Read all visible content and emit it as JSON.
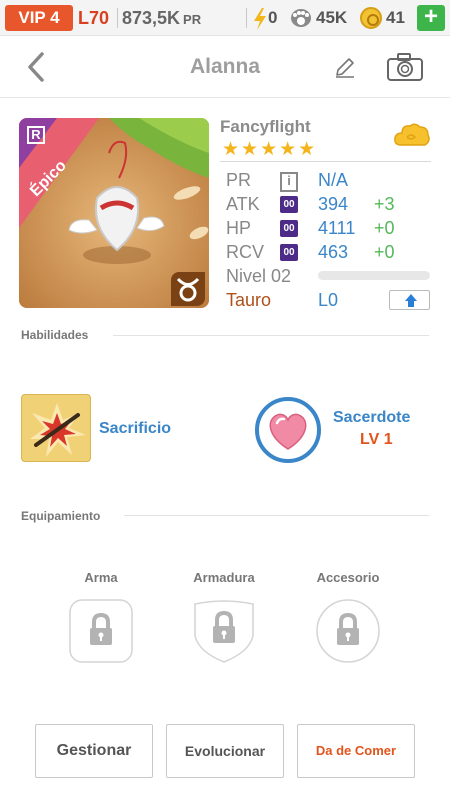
{
  "statusbar": {
    "vip": "VIP 4",
    "level": "L70",
    "power": "873,5K",
    "power_unit": "PR",
    "energy": "0",
    "paws": "45K",
    "coins": "41",
    "add": "+"
  },
  "header": {
    "title": "Alanna"
  },
  "card": {
    "rarity_letter": "R",
    "rarity": "Épico"
  },
  "pet": {
    "name": "Fancyflight",
    "stars": 5,
    "stars_text": "★★★★★",
    "stats": {
      "pr_label": "PR",
      "pr_value": "N/A",
      "atk_label": "ATK",
      "atk_badge": "00",
      "atk_value": "394",
      "atk_bonus": "+3",
      "hp_label": "HP",
      "hp_badge": "00",
      "hp_value": "4111",
      "hp_bonus": "+0",
      "rcv_label": "RCV",
      "rcv_badge": "00",
      "rcv_value": "463",
      "rcv_bonus": "+0",
      "level_label": "Nivel 02",
      "level_progress": 0,
      "sign_label": "Tauro",
      "sign_level": "L0"
    }
  },
  "sections": {
    "skills": "Habilidades",
    "equipment": "Equipamiento"
  },
  "skills": [
    {
      "name": "Sacrificio"
    },
    {
      "name": "Sacerdote",
      "level": "LV 1"
    }
  ],
  "equipment": [
    {
      "label": "Arma"
    },
    {
      "label": "Armadura"
    },
    {
      "label": "Accesorio"
    }
  ],
  "actions": {
    "manage": "Gestionar",
    "evolve": "Evolucionar",
    "feed": "Da de Comer"
  },
  "colors": {
    "accent_blue": "#3a86c8",
    "bonus_green": "#55b85a",
    "vip_orange": "#e8572b",
    "feed_red": "#e2541b"
  }
}
